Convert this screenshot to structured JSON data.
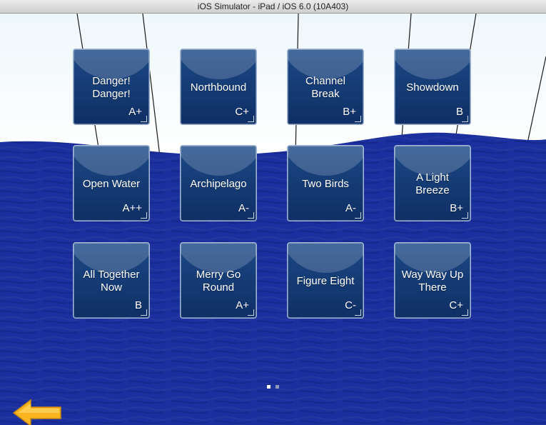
{
  "window": {
    "title": "iOS Simulator - iPad / iOS 6.0 (10A403)"
  },
  "levels": [
    {
      "name": "Danger!\nDanger!",
      "grade": "A+"
    },
    {
      "name": "Northbound",
      "grade": "C+"
    },
    {
      "name": "Channel\nBreak",
      "grade": "B+"
    },
    {
      "name": "Showdown",
      "grade": "B"
    },
    {
      "name": "Open Water",
      "grade": "A++"
    },
    {
      "name": "Archipelago",
      "grade": "A-"
    },
    {
      "name": "Two Birds",
      "grade": "A-"
    },
    {
      "name": "A Light\nBreeze",
      "grade": "B+"
    },
    {
      "name": "All Together\nNow",
      "grade": "B"
    },
    {
      "name": "Merry Go\nRound",
      "grade": "A+"
    },
    {
      "name": "Figure Eight",
      "grade": "C-"
    },
    {
      "name": "Way Way Up\nThere",
      "grade": "C+"
    }
  ],
  "pager": {
    "pages": 2,
    "current": 1
  },
  "colors": {
    "water": "#1a2f9c",
    "tile": "#173e78",
    "arrow": "#f7b31e"
  },
  "icons": {
    "back": "arrow-left-icon"
  }
}
